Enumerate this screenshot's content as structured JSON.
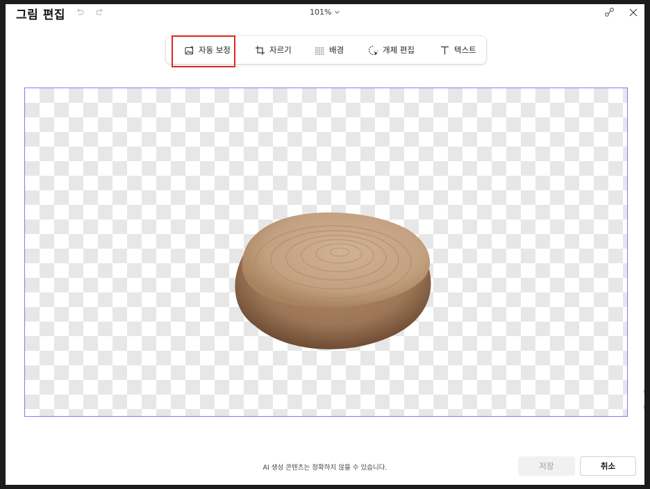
{
  "title": "그림 편집",
  "zoom": "101%",
  "toolbar": {
    "items": [
      {
        "label": "자동 보정",
        "icon": "auto-enhance-icon"
      },
      {
        "label": "자르기",
        "icon": "crop-icon"
      },
      {
        "label": "배경",
        "icon": "background-icon"
      },
      {
        "label": "개체 편집",
        "icon": "object-edit-icon"
      },
      {
        "label": "텍스트",
        "icon": "text-icon"
      }
    ],
    "selected": "자동 보정"
  },
  "canvas": {
    "border_color": "#9b6cf0",
    "checker_color": "#e7e7e7"
  },
  "footer": {
    "disclaimer": "AI 생성 콘텐츠는 정확하지 않을 수 있습니다.",
    "save_label": "저장",
    "cancel_label": "취소"
  },
  "colors": {
    "highlight": "#e0241b",
    "accent": "#9b6cf0"
  }
}
